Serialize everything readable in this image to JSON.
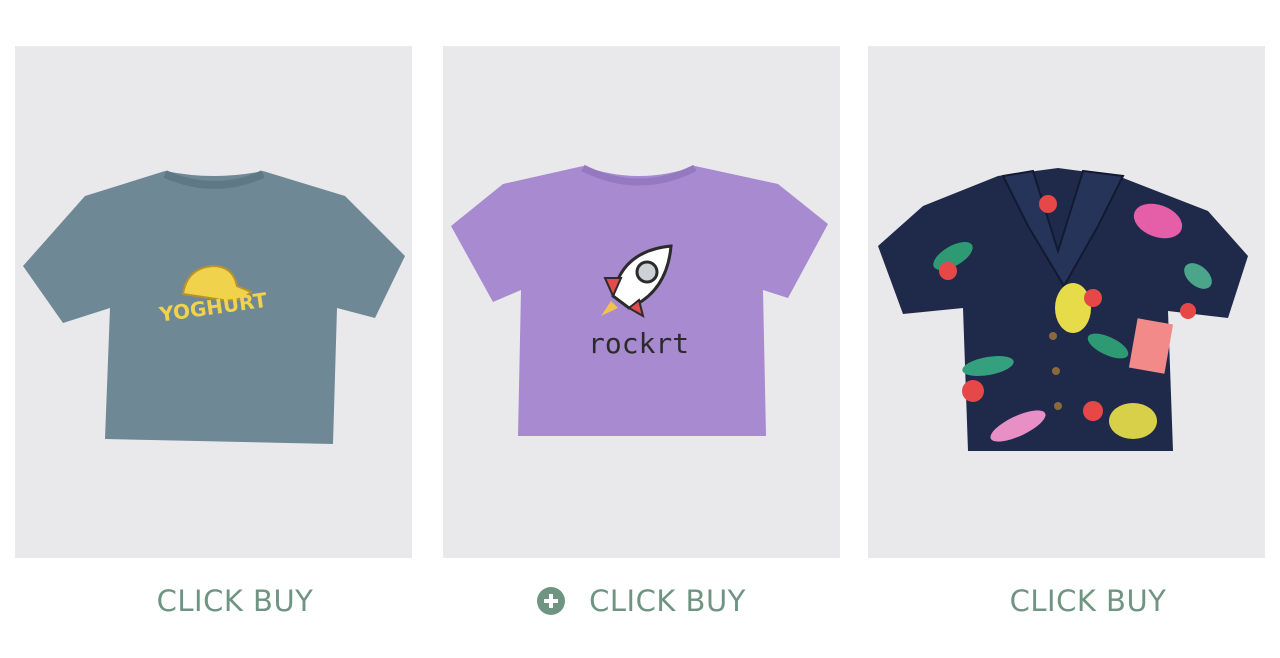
{
  "products": [
    {
      "id": "yoghurt-tee",
      "print_text": "YOGHURT",
      "shirt_color": "#6f8896",
      "print_color": "#f1d24c",
      "buy_label": "CLICK BUY",
      "has_plus_icon": false
    },
    {
      "id": "rocket-tee",
      "print_text": "rockrt",
      "shirt_color": "#a78ad0",
      "print_color": "#2b2b2b",
      "buy_label": "CLICK BUY",
      "has_plus_icon": true
    },
    {
      "id": "floral-shirt",
      "print_text": "",
      "shirt_color": "#1f2a4a",
      "buy_label": "CLICK BUY",
      "has_plus_icon": false
    }
  ],
  "colors": {
    "card_background": "#e9e9ec",
    "button_text": "#6f9482"
  }
}
